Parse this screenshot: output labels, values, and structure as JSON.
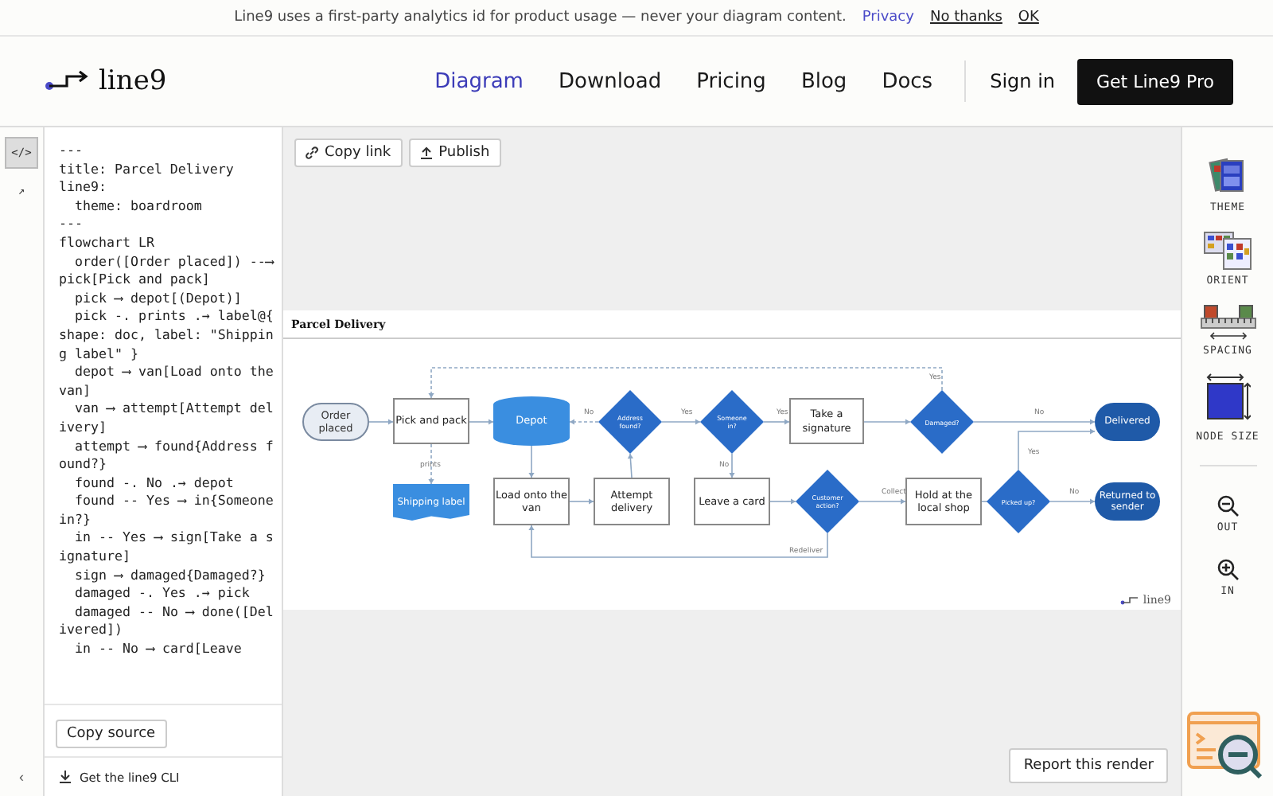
{
  "banner": {
    "message": "Line9 uses a first-party analytics id for product usage — never your diagram content.",
    "links": [
      "Privacy",
      "No thanks",
      "OK"
    ]
  },
  "header": {
    "logo": "line9",
    "nav": [
      {
        "label": "Diagram",
        "selected": true
      },
      {
        "label": "Download",
        "selected": false
      },
      {
        "label": "Pricing",
        "selected": false
      },
      {
        "label": "Blog",
        "selected": false
      },
      {
        "label": "Docs",
        "selected": false
      }
    ],
    "sign_in": "Sign in",
    "cta": "Get Line9 Pro"
  },
  "left_rail": {
    "tools": [
      {
        "label": "</>",
        "selected": true
      },
      {
        "label": "↗",
        "selected": false
      }
    ],
    "collapse": "‹"
  },
  "editor": {
    "code": [
      "---",
      "title: Parcel Delivery",
      "line9:",
      "  theme: boardroom",
      "---",
      "flowchart LR",
      "  order([Order placed]) --⟶ pick[Pick and pack]",
      "  pick ⟶ depot[(Depot)]",
      "  pick -. prints .→ label@{ shape: doc, label: \"Shipping label\" }",
      "  depot ⟶ van[Load onto the van]",
      "  van ⟶ attempt[Attempt delivery]",
      "  attempt ⟶ found{Address found?}",
      "  found -. No .→ depot",
      "  found -- Yes ⟶ in{Someone in?}",
      "  in -- Yes ⟶ sign[Take a signature]",
      "  sign ⟶ damaged{Damaged?}",
      "  damaged -. Yes .→ pick",
      "  damaged -- No ⟶ done([Delivered])",
      "  in -- No ⟶ card[Leave"
    ],
    "copy_button": "Copy source",
    "cli_link": "Get the line9 CLI"
  },
  "toolbar": [
    "Copy link",
    "Publish"
  ],
  "diagram": {
    "title": "Parcel Delivery",
    "brand": "line9",
    "nodes": [
      {
        "label": "Order placed",
        "kind": "start"
      },
      {
        "label": "Pick and pack",
        "kind": "process"
      },
      {
        "label": "Depot",
        "kind": "database"
      },
      {
        "label": "Address found?",
        "kind": "decision"
      },
      {
        "label": "Someone in?",
        "kind": "decision"
      },
      {
        "label": "Take a signature",
        "kind": "process"
      },
      {
        "label": "Damaged?",
        "kind": "decision"
      },
      {
        "label": "Delivered",
        "kind": "end"
      },
      {
        "label": "Shipping label",
        "kind": "document"
      },
      {
        "label": "Load onto the van",
        "kind": "process"
      },
      {
        "label": "Attempt delivery",
        "kind": "process"
      },
      {
        "label": "Leave a card",
        "kind": "process"
      },
      {
        "label": "Customer action?",
        "kind": "decision"
      },
      {
        "label": "Hold at the local shop",
        "kind": "process"
      },
      {
        "label": "Picked up?",
        "kind": "decision"
      },
      {
        "label": "Returned to sender",
        "kind": "end"
      }
    ],
    "edges": [
      {
        "dotted": false
      },
      {
        "dotted": false
      },
      {
        "label": "prints",
        "dotted": true
      },
      {
        "dotted": false
      },
      {
        "dotted": false
      },
      {
        "dotted": false
      },
      {
        "label": "No",
        "dotted": true
      },
      {
        "label": "Yes",
        "dotted": false
      },
      {
        "label": "Yes",
        "dotted": false
      },
      {
        "label": "No",
        "dotted": false
      },
      {
        "dotted": false
      },
      {
        "label": "Yes",
        "dotted": true
      },
      {
        "label": "No",
        "dotted": false
      },
      {
        "dotted": false
      },
      {
        "label": "Collect",
        "dotted": false
      },
      {
        "label": "Redeliver",
        "dotted": false
      },
      {
        "dotted": false
      },
      {
        "label": "Yes",
        "dotted": false
      },
      {
        "label": "No",
        "dotted": false
      }
    ]
  },
  "report_button": "Report this render",
  "right_rail": {
    "tools": [
      {
        "label": "THEME",
        "kind": "theme"
      },
      {
        "label": "ORIENT",
        "kind": "orient"
      },
      {
        "label": "SPACING",
        "kind": "spacing"
      },
      {
        "label": "NODE SIZE",
        "kind": "size"
      },
      {
        "label": "OUT",
        "kind": "zoom-out"
      },
      {
        "label": "IN",
        "kind": "zoom-in"
      }
    ]
  }
}
